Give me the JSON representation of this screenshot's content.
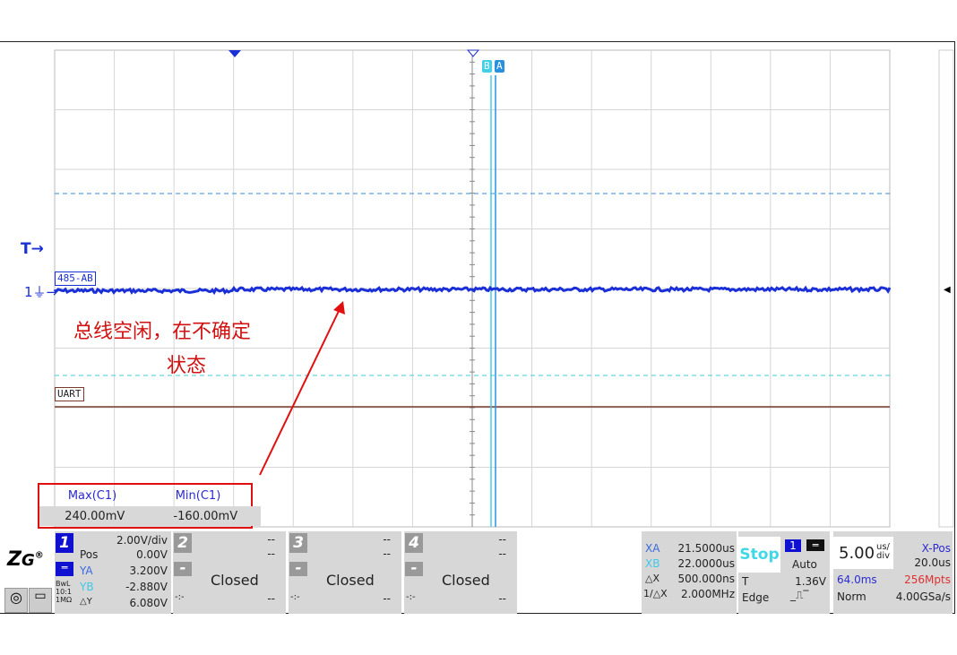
{
  "screen": {
    "trace_label": "485-AB",
    "uart_label": "UART",
    "trigger_marker": "T",
    "channel_marker": "1",
    "cursor_b": "B",
    "cursor_a": "A",
    "colors": {
      "trace": "#1a2fd6",
      "uart": "#7a3a2a",
      "cursor_a": "#2a90e0",
      "cursor_b": "#40d0e8",
      "grid": "#d6d6d6"
    }
  },
  "annotation": {
    "line1": "总线空闲，在不确定",
    "line2": "状态"
  },
  "measure": {
    "headers": [
      "Max(C1)",
      "Min(C1)"
    ],
    "values": [
      "240.00mV",
      "-160.00mV"
    ]
  },
  "logo": "ZLG",
  "ch1": {
    "num": "1",
    "scale": "2.00V/div",
    "pos_label": "Pos",
    "pos": "0.00V",
    "ya_label": "YA",
    "ya": "3.200V",
    "yb_label": "YB",
    "yb": "-2.880V",
    "dy_label": "△Y",
    "dy": "6.080V",
    "bw": "BwL",
    "probe": "10:1",
    "imp": "1MΩ"
  },
  "channels": [
    {
      "num": "2",
      "status": "Closed",
      "dash": "--",
      "coup": "-:-"
    },
    {
      "num": "3",
      "status": "Closed",
      "dash": "--",
      "coup": "-:-"
    },
    {
      "num": "4",
      "status": "Closed",
      "dash": "--",
      "coup": "-:-"
    }
  ],
  "cursors": {
    "xa_label": "XA",
    "xa": "21.5000us",
    "xb_label": "XB",
    "xb": "22.0000us",
    "dx_label": "△X",
    "dx": "500.000ns",
    "inv_label": "1/△X",
    "inv": "2.000MHz"
  },
  "run": {
    "state": "Stop",
    "trig_src": "1",
    "mode": "Auto",
    "t_label": "T",
    "level": "1.36V",
    "type": "Edge"
  },
  "timebase": {
    "value": "5.00",
    "unit_top": "us/",
    "unit_bot": "div",
    "xpos_label": "X-Pos",
    "xpos": "20.0us",
    "span": "64.0ms",
    "mem": "256Mpts",
    "acq": "Norm",
    "rate": "4.00GSa/s"
  }
}
